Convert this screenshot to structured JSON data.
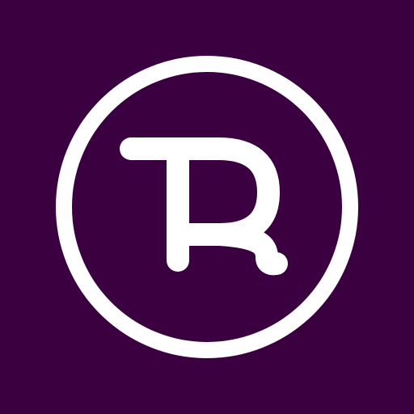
{
  "app_icon": {
    "logo_lettering": "TR",
    "icon_name": "tr-monogram-logo-icon",
    "colors": {
      "background": "#3a0040",
      "foreground": "#ffffff"
    }
  }
}
